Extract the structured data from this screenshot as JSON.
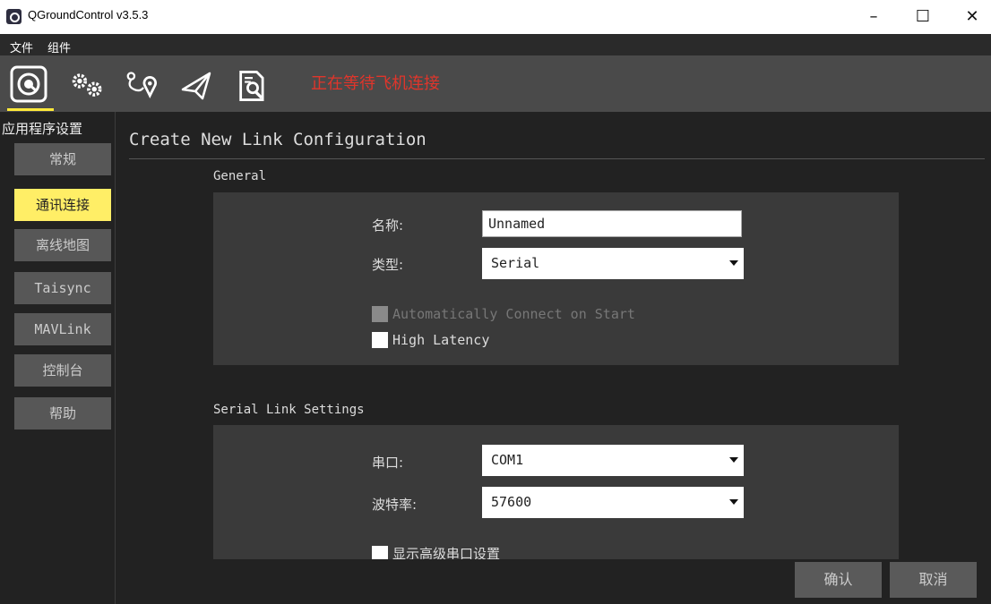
{
  "window": {
    "title": "QGroundControl v3.5.3",
    "min": "–",
    "max": "☐",
    "close": "✕"
  },
  "menu": {
    "items": [
      "文件",
      "组件"
    ]
  },
  "toolbar": {
    "status": "正在等待飞机连接"
  },
  "sidebar": {
    "title": "应用程序设置",
    "items": [
      {
        "label": "常规"
      },
      {
        "label": "通讯连接"
      },
      {
        "label": "离线地图"
      },
      {
        "label": "Taisync"
      },
      {
        "label": "MAVLink"
      },
      {
        "label": "控制台"
      },
      {
        "label": "帮助"
      }
    ]
  },
  "main": {
    "title": "Create New Link Configuration",
    "general": {
      "label": "General",
      "name_label": "名称:",
      "name_value": "Unnamed",
      "type_label": "类型:",
      "type_value": "Serial",
      "auto_connect": "Automatically Connect on Start",
      "high_latency": "High Latency"
    },
    "serial": {
      "label": "Serial Link Settings",
      "port_label": "串口:",
      "port_value": "COM1",
      "baud_label": "波特率:",
      "baud_value": "57600",
      "advanced": "显示高级串口设置"
    }
  },
  "buttons": {
    "confirm": "确认",
    "cancel": "取消"
  },
  "colors": {
    "accent": "#ffee66",
    "status": "#e0352b"
  }
}
